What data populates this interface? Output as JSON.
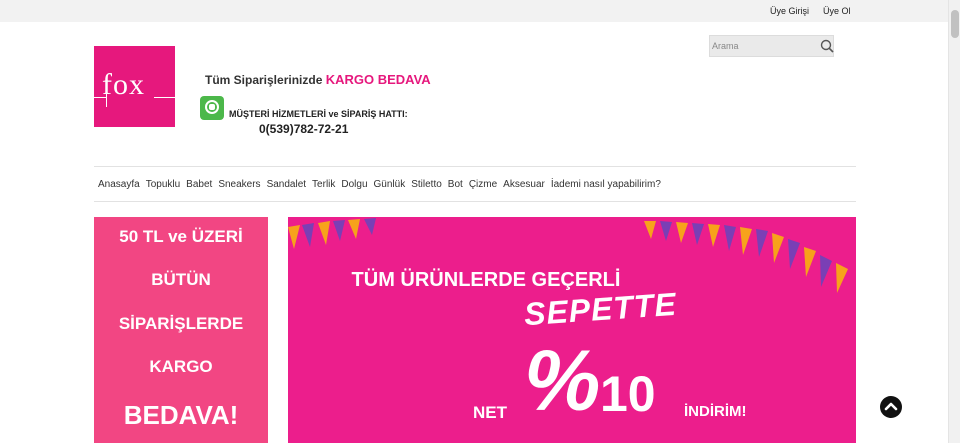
{
  "topbar": {
    "login_label": "Üye Girişi",
    "signup_label": "Üye Ol"
  },
  "logo": {
    "text": "fox"
  },
  "header": {
    "promo_text": "Tüm Siparişlerinizde",
    "promo_highlight": "KARGO BEDAVA",
    "hotline_label": "MÜŞTERİ HİZMETLERİ ve SİPARİŞ HATTI:",
    "hotline_number": "0(539)782-72-21"
  },
  "search": {
    "placeholder": "Arama"
  },
  "nav": {
    "items": [
      "Anasayfa",
      "Topuklu",
      "Babet",
      "Sneakers",
      "Sandalet",
      "Terlik",
      "Dolgu",
      "Günlük",
      "Stiletto",
      "Bot",
      "Çizme",
      "Aksesuar",
      "İademi nasıl yapabilirim?"
    ]
  },
  "left_banner": {
    "lines": [
      "50 TL ve ÜZERİ",
      "BÜTÜN",
      "SİPARİŞLERDE",
      "KARGO",
      "BEDAVA!"
    ]
  },
  "main_banner": {
    "headline": "TÜM ÜRÜNLERDE GEÇERLİ",
    "sepette": "SEPETTE",
    "net": "NET",
    "percent_sign": "%",
    "amount": "10",
    "discount": "İNDİRİM!"
  },
  "colors": {
    "brand": "#e6187d",
    "left_banner": "#f24683",
    "main_banner": "#ec1e8c"
  },
  "icons": {
    "search": "magnifier-icon",
    "scroll_top": "chevron-up-icon",
    "whatsapp": "whatsapp-icon"
  }
}
